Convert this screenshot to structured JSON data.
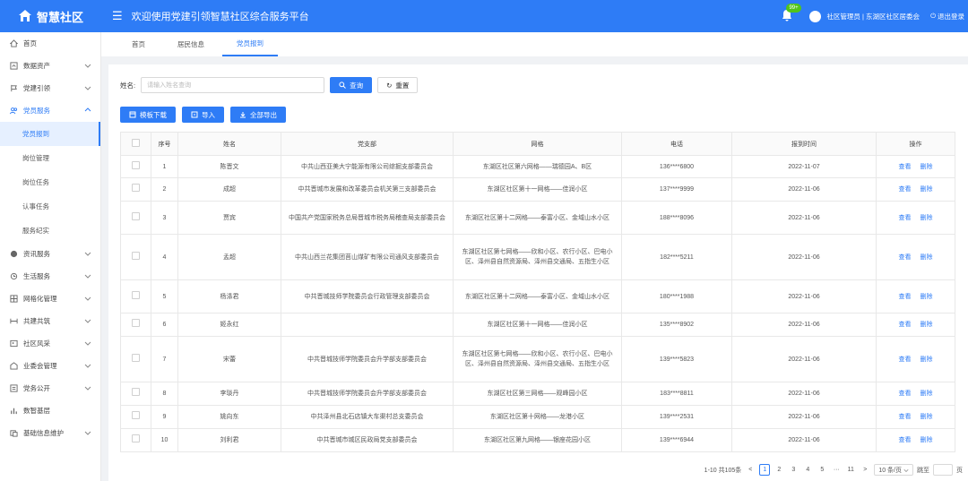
{
  "header": {
    "logo_text": "智慧社区",
    "title": "欢迎使用党建引领智慧社区综合服务平台",
    "badge": "99+",
    "user": "社区管理员 | 东湖区社区居委会",
    "logout": "退出登录"
  },
  "sidebar": {
    "items": [
      {
        "label": "首页",
        "icon": "home-icon"
      },
      {
        "label": "数据资产",
        "icon": "database-icon"
      },
      {
        "label": "党建引领",
        "icon": "flag-icon"
      },
      {
        "label": "党员服务",
        "icon": "members-icon"
      },
      {
        "label": "资讯服务",
        "icon": "globe-icon"
      },
      {
        "label": "生活服务",
        "icon": "life-icon"
      },
      {
        "label": "网格化管理",
        "icon": "grid-icon"
      },
      {
        "label": "共建共筑",
        "icon": "build-icon"
      },
      {
        "label": "社区风采",
        "icon": "image-icon"
      },
      {
        "label": "业委会管理",
        "icon": "committee-icon"
      },
      {
        "label": "党务公开",
        "icon": "notice-icon"
      },
      {
        "label": "数智基层",
        "icon": "chart-icon"
      },
      {
        "label": "基础信息维护",
        "icon": "settings-icon"
      }
    ],
    "sub_items": [
      "党员报到",
      "岗位管理",
      "岗位任务",
      "认事任务",
      "服务纪实"
    ]
  },
  "tabs": [
    "首页",
    "居民信息",
    "党员报到"
  ],
  "search": {
    "label": "姓名:",
    "placeholder": "请输入姓名查询",
    "query_btn": "查询",
    "reset_btn": "重置"
  },
  "actions": {
    "template_btn": "模板下载",
    "import_btn": "导入",
    "export_btn": "全部导出"
  },
  "table": {
    "headers": [
      "序号",
      "姓名",
      "党支部",
      "网格",
      "电话",
      "报到时间",
      "操作"
    ],
    "view_label": "查看",
    "delete_label": "删除",
    "rows": [
      {
        "no": "1",
        "name": "陈晋文",
        "branch": "中共山西亚美大宁能源有限公司综掘支部委员会",
        "grid": "东湖区社区第六网格——瑞德园A、B区",
        "phone": "136****6800",
        "date": "2022-11-07"
      },
      {
        "no": "2",
        "name": "成超",
        "branch": "中共晋城市发展和改革委员会机关第三支部委员会",
        "grid": "东湖区社区第十一网格——佳润小区",
        "phone": "137****9999",
        "date": "2022-11-06"
      },
      {
        "no": "3",
        "name": "贾宾",
        "branch": "中国共产党国家税务总局晋城市税务局稽查局支部委员会",
        "grid": "东湖区社区第十二网格——泰富小区、金域山水小区",
        "phone": "188****8096",
        "date": "2022-11-06"
      },
      {
        "no": "4",
        "name": "孟超",
        "branch": "中共山西兰花集团莒山煤矿有限公司通风支部委员会",
        "grid": "东湖区社区第七网格——欣和小区、农行小区、巴电小区、泽州县自然资源局、泽州县交通局、五指生小区",
        "phone": "182****5211",
        "date": "2022-11-06"
      },
      {
        "no": "5",
        "name": "杨涤君",
        "branch": "中共晋城技师学院委员会行政管理支部委员会",
        "grid": "东湖区社区第十二网格——泰富小区、金域山水小区",
        "phone": "180****1988",
        "date": "2022-11-06"
      },
      {
        "no": "6",
        "name": "姬永红",
        "branch": "",
        "grid": "东湖区社区第十一网格——佳润小区",
        "phone": "135****8902",
        "date": "2022-11-06"
      },
      {
        "no": "7",
        "name": "宋蕾",
        "branch": "中共晋城技师学院委员会升学部支部委员会",
        "grid": "东湖区社区第七网格——欣和小区、农行小区、巴电小区、泽州县自然资源局、泽州县交通局、五指生小区",
        "phone": "139****5823",
        "date": "2022-11-06"
      },
      {
        "no": "8",
        "name": "李琰丹",
        "branch": "中共晋城技师学院委员会升学部支部委员会",
        "grid": "东湖区社区第三网格——观峰园小区",
        "phone": "183****8811",
        "date": "2022-11-06"
      },
      {
        "no": "9",
        "name": "姚向东",
        "branch": "中共泽州县北石店镇大车渠村总支委员会",
        "grid": "东湖区社区第十网格——龙港小区",
        "phone": "139****2531",
        "date": "2022-11-06"
      },
      {
        "no": "10",
        "name": "刘利君",
        "branch": "中共晋城市城区民政局党支部委员会",
        "grid": "东湖区社区第九网格——银座花园小区",
        "phone": "139****6944",
        "date": "2022-11-06"
      }
    ]
  },
  "pagination": {
    "summary": "1-10 共105条",
    "pages": [
      "1",
      "2",
      "3",
      "4",
      "5",
      "···",
      "11"
    ],
    "page_size": "10 条/页",
    "goto": "跳至",
    "page_unit": "页"
  },
  "colors": {
    "primary": "#2e7cf6",
    "header_bg": "#2e7cf6"
  }
}
